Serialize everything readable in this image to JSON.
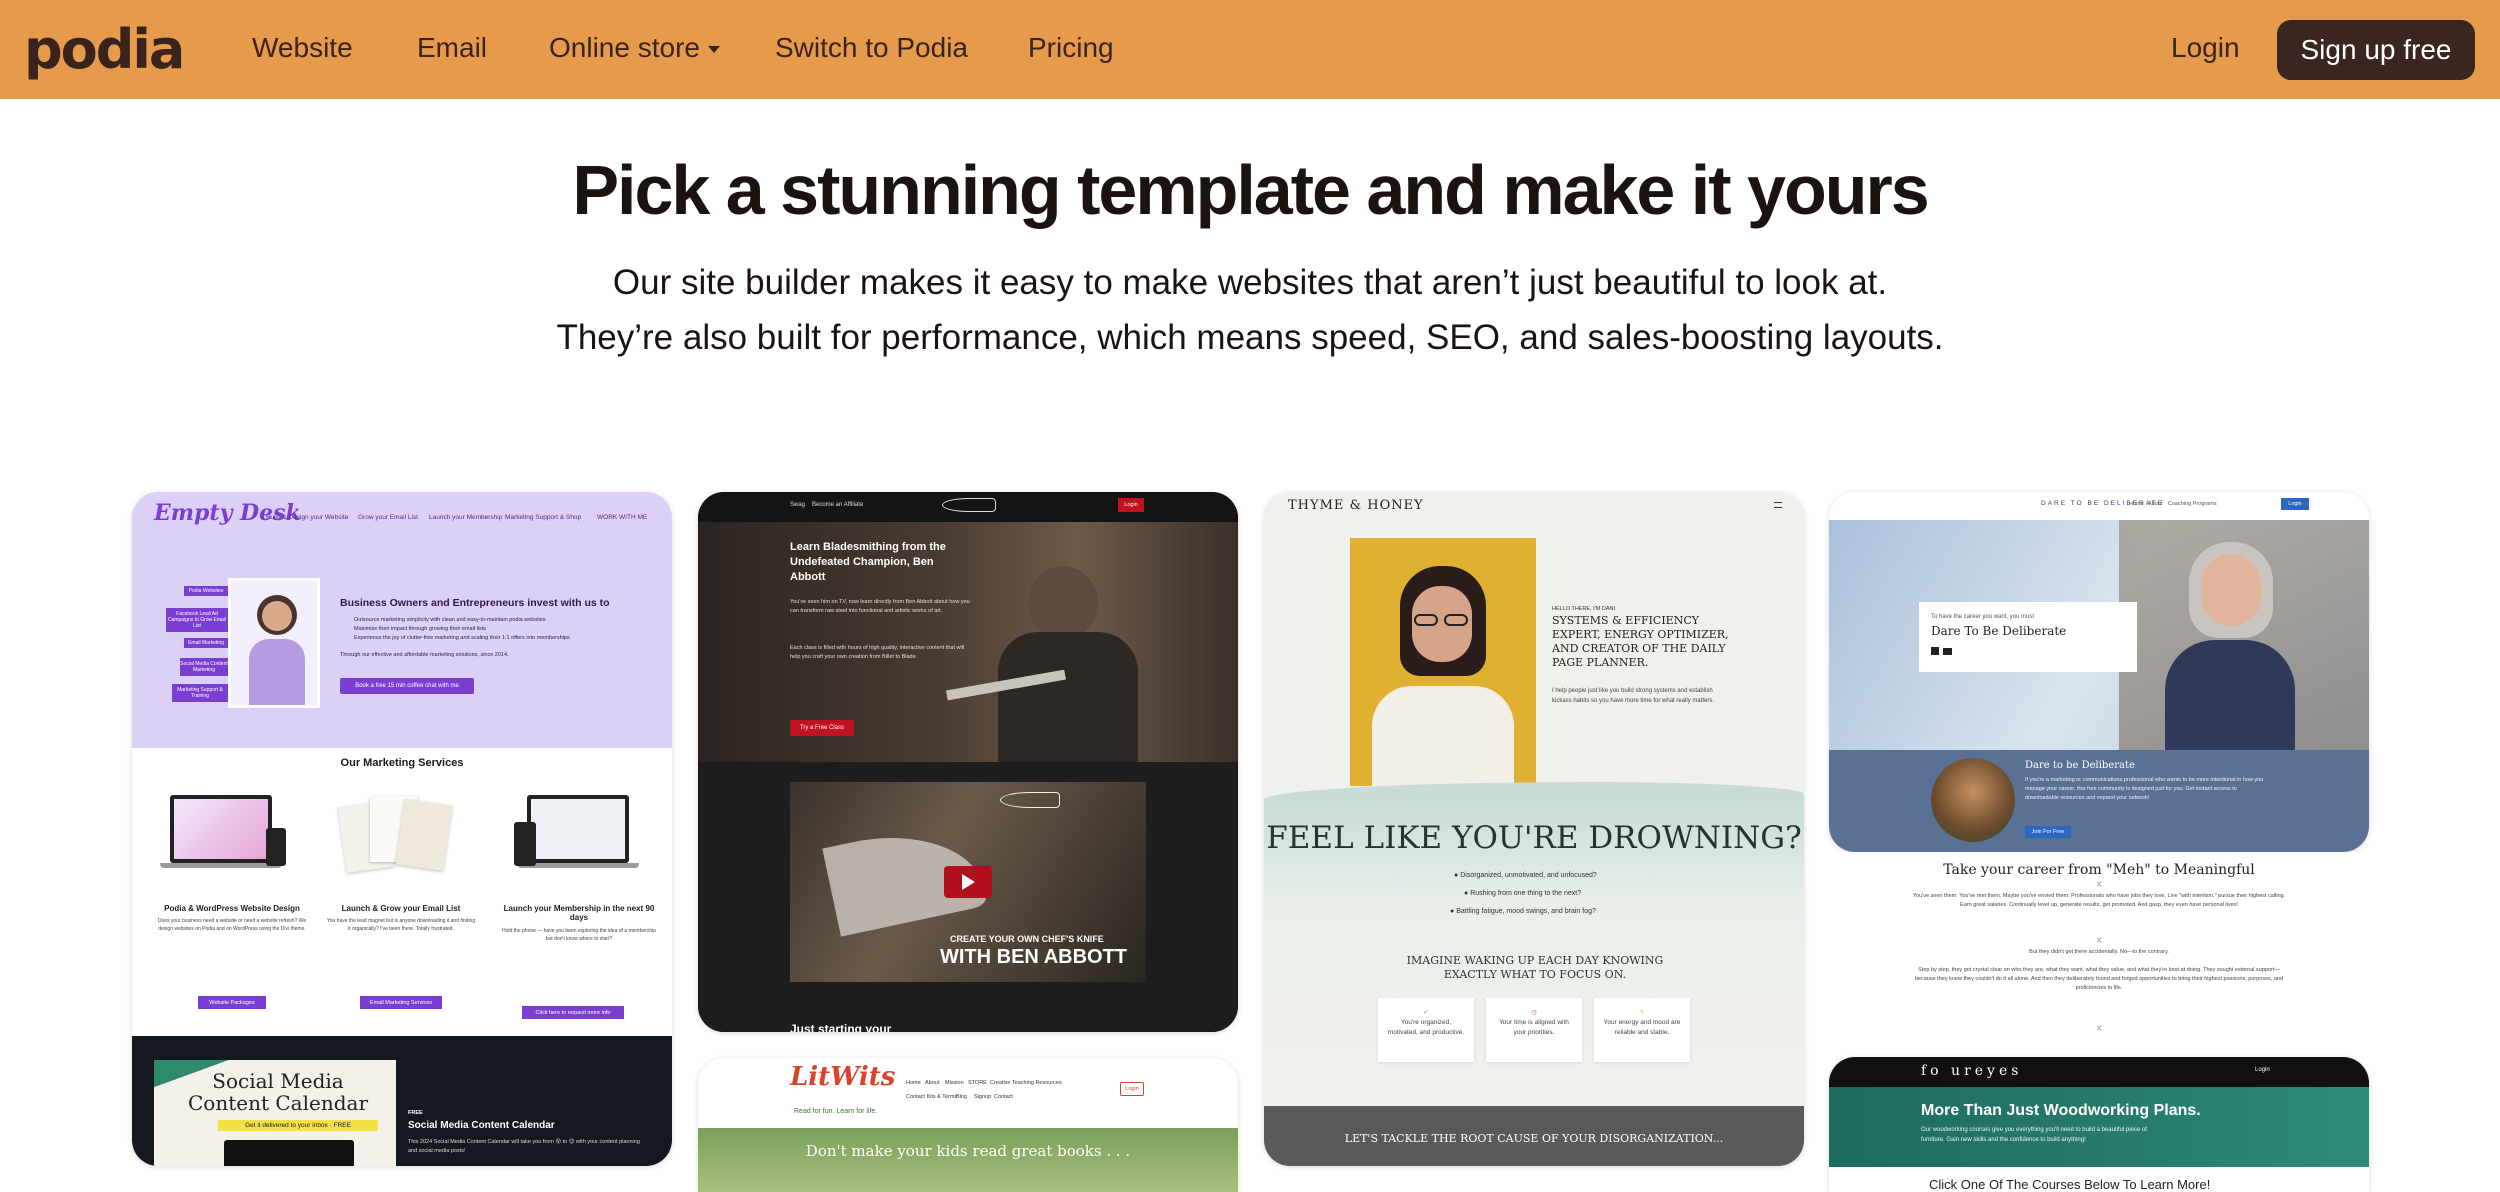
{
  "brand": {
    "logo": "podia"
  },
  "nav": {
    "links": [
      "Website",
      "Email",
      "Online store",
      "Switch to Podia",
      "Pricing"
    ],
    "login": "Login",
    "signup": "Sign up free"
  },
  "hero": {
    "title": "Pick a stunning template and make it yours",
    "subtitle_line1": "Our site builder makes it easy to make websites that aren’t just beautiful to look at.",
    "subtitle_line2": "They’re also built for performance, which means speed, SEO, and sales-boosting layouts."
  },
  "templates": {
    "empty_desk": {
      "logo": "Empty Desk",
      "nav": [
        "Build & Design your Website",
        "Grow your Email List",
        "Launch your Membership",
        "Marketing Support & Shop",
        "WORK WITH ME"
      ],
      "tags": [
        "Podia Websites",
        "Facebook Lead Ad Campaigns to Grow Email List",
        "Email Marketing",
        "Social Media Content Marketing",
        "Marketing Support & Training"
      ],
      "headline": "Business Owners and Entrepreneurs invest with us to",
      "bullets": [
        "Outsource marketing simplicity with clean and easy-to-maintain podia websites",
        "Maximize their impact through growing their email lists",
        "Experience the joy of clutter-free marketing and scaling their 1:1 offers into memberships"
      ],
      "note": "Through our effective and affordable marketing solutions, since 2014.",
      "cta": "Book a free 15 min coffee chat with me",
      "services_title": "Our Marketing Services",
      "services": [
        {
          "title": "Podia & WordPress Website Design",
          "body": "Does your business need a website or need a website refresh? We design websites on Podia and on WordPress using the Divi theme.",
          "button": "Website Packages"
        },
        {
          "title": "Launch & Grow your Email List",
          "body": "You have the lead magnet but is anyone downloading it and finding it organically? I've been there. Totally frustrated.",
          "button": "Email Marketing Services"
        },
        {
          "title": "Launch your Membership in the next 90 days",
          "body": "Hold the phone — have you been exploring the idea of a membership but don't know where to start?",
          "button": "Click here to request more info"
        }
      ],
      "promo_image_title": "Social Media Content Calendar",
      "promo_image_strip": "Get it delivered to your inbox · FREE",
      "promo_kicker": "FREE",
      "promo_title": "Social Media Content Calendar",
      "promo_body": "This 2024 Social Media Content Calendar will take you from 😵 to 😊 with your content planning and social media posts!"
    },
    "bladesmithing": {
      "nav": [
        "Swag",
        "Become an Affiliate"
      ],
      "login": "Login",
      "headline": "Learn Bladesmithing from the Undefeated Champion, Ben Abbott",
      "body1": "You've seen him on TV, now learn directly from Ben Abbott about how you can transform raw steel into functional and artistic works of art.",
      "body2": "Each class is filled with hours of high quality, interactive content that will help you craft your own creation from Billet to Blade.",
      "cta": "Try a Free Class",
      "video_line1": "CREATE YOUR OWN CHEF'S KNIFE",
      "video_line2": "WITH BEN ABBOTT",
      "footer": "Just starting your"
    },
    "thyme_honey": {
      "logo": "THYME & HONEY",
      "kicker": "HELLO THERE, I'M DANI",
      "headline": "SYSTEMS & EFFICIENCY EXPERT, ENERGY OPTIMIZER, AND CREATOR OF THE DAILY PAGE PLANNER.",
      "body": "I help people just like you build strong systems and establish kickass habits so you have more time for what really matters.",
      "question": "FEEL LIKE YOU'RE DROWNING?",
      "list": [
        "Disorganized, unmotivated, and unfocused?",
        "Rushing from one thing to the next?",
        "Battling fatigue, mood swings, and brain fog?"
      ],
      "imagine": "IMAGINE WAKING UP EACH DAY KNOWING EXACTLY WHAT TO FOCUS ON.",
      "benefits": [
        "You're organized, motivated, and productive.",
        "Your time is aligned with your priorities.",
        "Your energy and mood are reliable and stable."
      ],
      "footer": "LET'S TACKLE THE ROOT CAUSE OF YOUR DISORGANIZATION..."
    },
    "dare": {
      "logo": "DARE TO BE DELIBERATE",
      "nav": [
        "Home",
        "About",
        "Coaching Programs"
      ],
      "login": "Login",
      "box_kicker": "To have the career you want, you must",
      "box_title": "Dare To Be Deliberate",
      "band_title": "Dare to be Deliberate",
      "band_body": "If you're a marketing or communications professional who wants to be more intentional in how you manage your career, this free community is designed just for you. Get instant access to downloadable resources and expand your network!",
      "band_button": "Join For Free",
      "section_title": "Take your career from \"Meh\" to Meaningful",
      "section_body": "You've seen them. You've met them. Maybe you've envied them: Professionals who have jobs they love. Live \"with intention,\" pursue their highest calling. Earn great salaries. Continually level up, generate results, get promoted. And gasp, they even have personal lives!",
      "section_body2": "But they didn't get there accidentally. No—to the contrary.",
      "section_body3": "Step by step, they got crystal clear on who they are, what they want, what they value, and what they're best at doing. They sought external support—because they knew they couldn't do it all alone. And then they deliberately found and forged opportunities to bring their highest passions, purposes, and proficiencies to life."
    },
    "litwits": {
      "logo": "LitWits",
      "tagline": "Read for fun. Learn for life.",
      "nav_row1": [
        "Home",
        "About",
        "Mission",
        "STORE",
        "Creative Teaching Resources"
      ],
      "nav_row2": [
        "Contact Kits & Terms",
        "Blog",
        "Signup",
        "Contact"
      ],
      "login": "Login",
      "hero": "Don't make your kids read great books . . ."
    },
    "foureyes": {
      "logo": "fo ureyes",
      "login": "Login",
      "title": "More Than Just Woodworking Plans.",
      "body": "Our woodworking courses give you everything you'll need to build a beautiful piece of furniture. Gain new skills and the confidence to build anything!",
      "footer": "Click One Of The Courses Below To Learn More!"
    }
  }
}
